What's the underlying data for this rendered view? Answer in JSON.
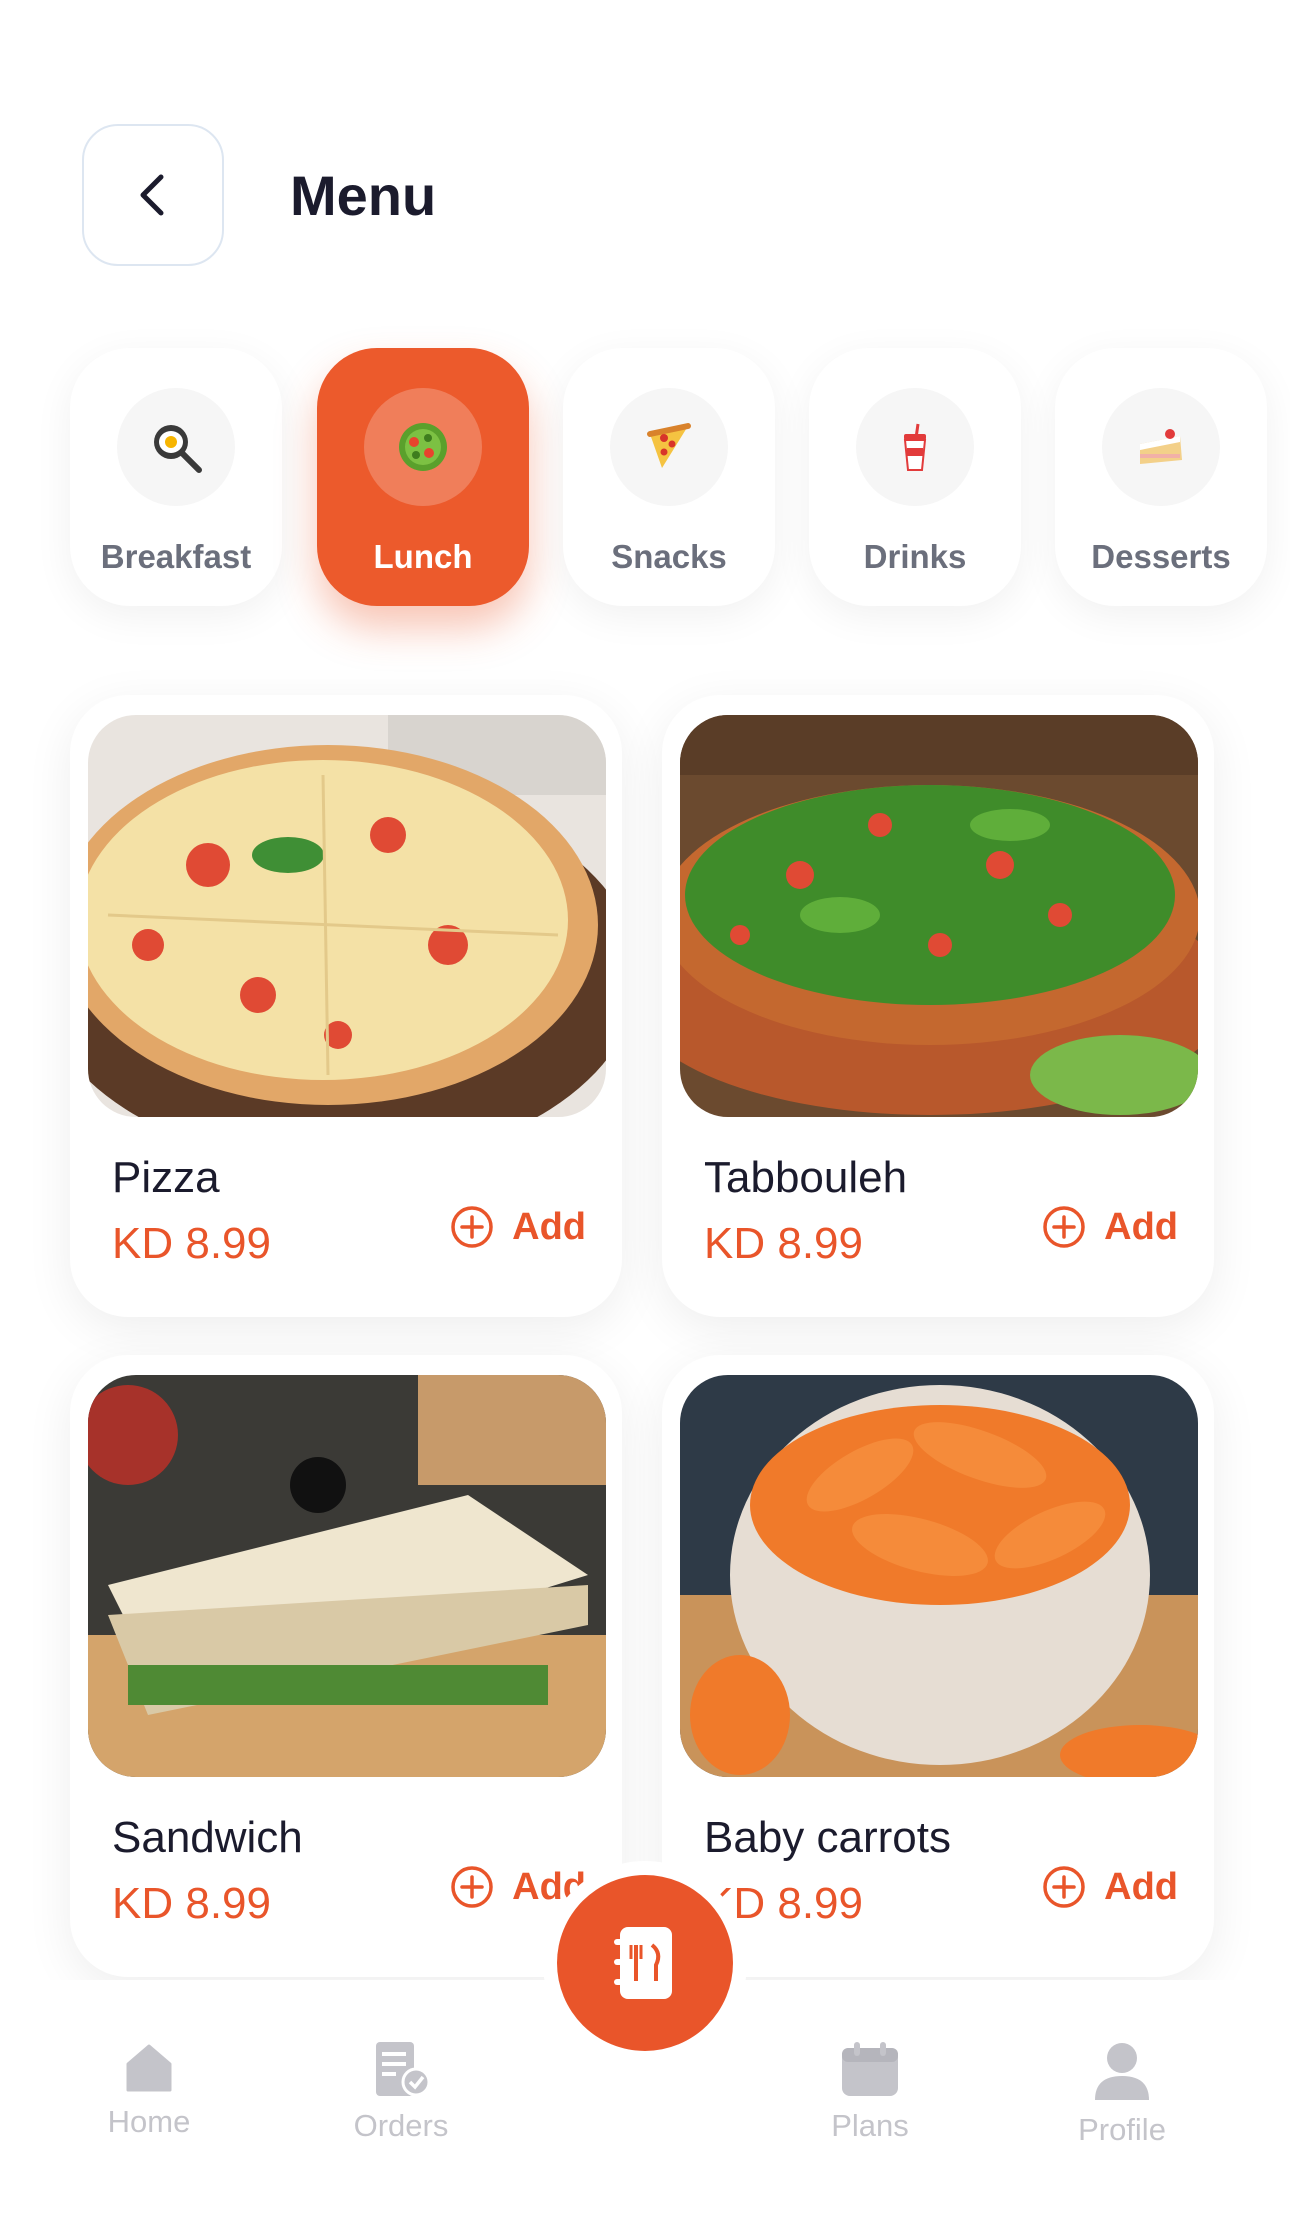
{
  "header": {
    "title": "Menu"
  },
  "categories": [
    {
      "label": "Breakfast",
      "icon": "frying-pan-icon",
      "active": false
    },
    {
      "label": "Lunch",
      "icon": "salad-icon",
      "active": true
    },
    {
      "label": "Snacks",
      "icon": "pizza-slice-icon",
      "active": false
    },
    {
      "label": "Drinks",
      "icon": "cup-with-straw-icon",
      "active": false
    },
    {
      "label": "Desserts",
      "icon": "cake-slice-icon",
      "active": false
    }
  ],
  "products": [
    {
      "name": "Pizza",
      "price": "KD 8.99",
      "add_label": "Add"
    },
    {
      "name": "Tabbouleh",
      "price": "KD 8.99",
      "add_label": "Add"
    },
    {
      "name": "Sandwich",
      "price": "KD 8.99",
      "add_label": "Add"
    },
    {
      "name": "Baby carrots",
      "price": "KD 8.99",
      "add_label": "Add"
    }
  ],
  "nav": {
    "items": [
      {
        "label": "Home",
        "icon": "home-icon"
      },
      {
        "label": "Orders",
        "icon": "receipt-icon"
      },
      {
        "label": "Plans",
        "icon": "calendar-icon"
      },
      {
        "label": "Profile",
        "icon": "user-icon"
      }
    ],
    "center_icon": "menu-book-icon"
  },
  "colors": {
    "accent": "#e9552a",
    "active_category": "#ec5a2c",
    "text": "#1b1b2d",
    "muted": "#c4c4ca"
  }
}
